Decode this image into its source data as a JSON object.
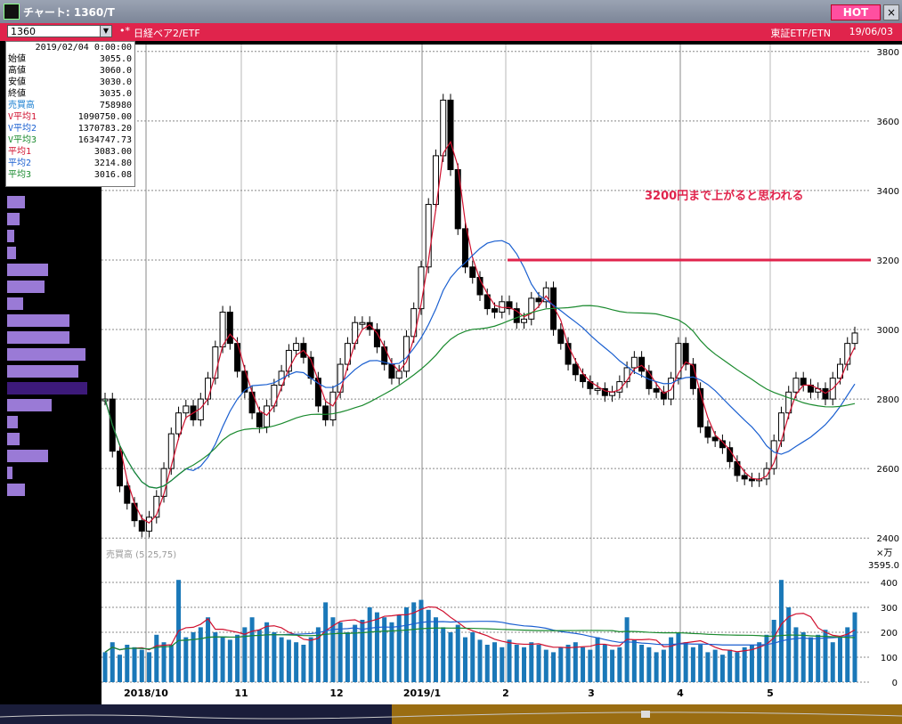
{
  "window": {
    "title": "チャート: 1360/T",
    "hot_label": "HOT",
    "close_label": "×"
  },
  "symbol_bar": {
    "code": "1360",
    "marker": "•*",
    "issue": "日経ベア2/ETF",
    "market": "東証ETF/ETN",
    "date": "19/06/03"
  },
  "info_panel": {
    "datetime": "2019/02/04 0:00:00",
    "rows": [
      {
        "label": "始値",
        "value": "3055.0",
        "color": "#000000"
      },
      {
        "label": "高値",
        "value": "3060.0",
        "color": "#000000"
      },
      {
        "label": "安値",
        "value": "3030.0",
        "color": "#000000"
      },
      {
        "label": "終値",
        "value": "3035.0",
        "color": "#000000"
      },
      {
        "label": "売買高",
        "value": "758980",
        "color": "#1a7fd0"
      },
      {
        "label": "V平均1",
        "value": "1090750.00",
        "color": "#d0102e"
      },
      {
        "label": "V平均2",
        "value": "1370783.20",
        "color": "#1a5fd0"
      },
      {
        "label": "V平均3",
        "value": "1634747.73",
        "color": "#1a8a2e"
      },
      {
        "label": "平均1",
        "value": "3083.00",
        "color": "#d0102e"
      },
      {
        "label": "平均2",
        "value": "3214.80",
        "color": "#1a5fd0"
      },
      {
        "label": "平均3",
        "value": "3016.08",
        "color": "#1a8a2e"
      }
    ]
  },
  "annotation": {
    "text": "3200円まで上がると思われる",
    "color": "#e0244c",
    "line_value": 3200
  },
  "chart_data": {
    "type": "candlestick",
    "price_axis": {
      "ticks": [
        2400,
        2600,
        2800,
        3000,
        3200,
        3400,
        3600,
        3800
      ],
      "range": [
        2380,
        3820
      ]
    },
    "volume_axis": {
      "label": "売買高 (5,25,75)",
      "unit": "×万",
      "ticks": [
        0,
        100,
        200,
        300,
        400
      ],
      "range": [
        0,
        450
      ],
      "current": "3595.0"
    },
    "x_labels": [
      "2018/10",
      "11",
      "12",
      "2019/1",
      "2",
      "3",
      "4",
      "5"
    ],
    "colors": {
      "ma_short": "#d0102e",
      "ma_mid": "#1a5fd0",
      "ma_long": "#1a8a2e",
      "volume": "#1a78b8",
      "grid": "#888888",
      "volume_profile": "#9a7ad6"
    },
    "price_points": [
      2800,
      2650,
      2550,
      2500,
      2450,
      2420,
      2460,
      2520,
      2600,
      2700,
      2760,
      2780,
      2740,
      2800,
      2860,
      2950,
      3050,
      2960,
      2880,
      2820,
      2760,
      2720,
      2780,
      2840,
      2880,
      2940,
      2960,
      2920,
      2860,
      2780,
      2740,
      2820,
      2900,
      2960,
      3020,
      3020,
      3000,
      2950,
      2900,
      2860,
      2880,
      2980,
      3060,
      3180,
      3360,
      3500,
      3660,
      3460,
      3290,
      3180,
      3150,
      3100,
      3060,
      3050,
      3080,
      3060,
      3020,
      3030,
      3090,
      3080,
      3120,
      3000,
      2960,
      2900,
      2870,
      2850,
      2830,
      2830,
      2810,
      2820,
      2850,
      2890,
      2920,
      2880,
      2830,
      2820,
      2800,
      2860,
      2960,
      2900,
      2830,
      2720,
      2690,
      2680,
      2660,
      2620,
      2580,
      2570,
      2565,
      2570,
      2600,
      2680,
      2760,
      2820,
      2860,
      2840,
      2820,
      2830,
      2800,
      2860,
      2900,
      2960,
      2990
    ],
    "volume_points": [
      120,
      160,
      110,
      150,
      140,
      130,
      120,
      190,
      160,
      150,
      410,
      180,
      200,
      220,
      260,
      200,
      180,
      170,
      190,
      220,
      260,
      210,
      240,
      200,
      180,
      170,
      160,
      150,
      180,
      220,
      320,
      260,
      240,
      200,
      230,
      250,
      300,
      280,
      260,
      240,
      270,
      300,
      320,
      330,
      290,
      260,
      220,
      200,
      230,
      180,
      200,
      170,
      150,
      160,
      140,
      170,
      150,
      140,
      160,
      150,
      130,
      120,
      140,
      150,
      160,
      140,
      130,
      180,
      150,
      130,
      140,
      260,
      170,
      150,
      140,
      120,
      130,
      180,
      200,
      160,
      140,
      150,
      120,
      130,
      110,
      130,
      120,
      140,
      150,
      160,
      190,
      250,
      410,
      300,
      220,
      200,
      180,
      190,
      210,
      160,
      180,
      220,
      280
    ]
  }
}
